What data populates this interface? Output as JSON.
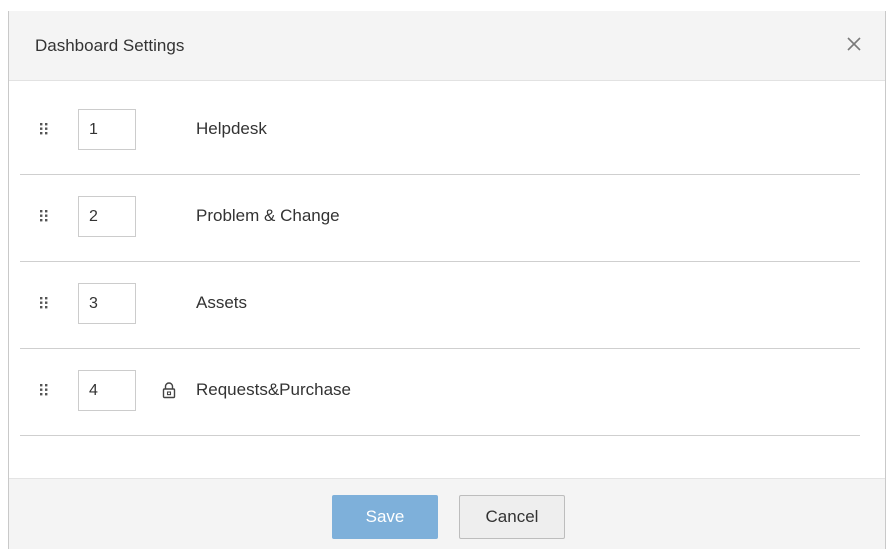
{
  "dialog": {
    "title": "Dashboard Settings",
    "close_icon": "close-icon"
  },
  "rows": [
    {
      "order": "1",
      "label": "Helpdesk",
      "locked": false
    },
    {
      "order": "2",
      "label": "Problem & Change",
      "locked": false
    },
    {
      "order": "3",
      "label": "Assets",
      "locked": false
    },
    {
      "order": "4",
      "label": "Requests&Purchase",
      "locked": true
    }
  ],
  "footer": {
    "save_label": "Save",
    "cancel_label": "Cancel"
  },
  "colors": {
    "save_button": "#7eb0da",
    "header_bg": "#f4f4f4",
    "divider": "#cfcfcf"
  },
  "icons": {
    "drag": "drag-handle-icon",
    "lock": "lock-icon",
    "close": "close-icon"
  }
}
